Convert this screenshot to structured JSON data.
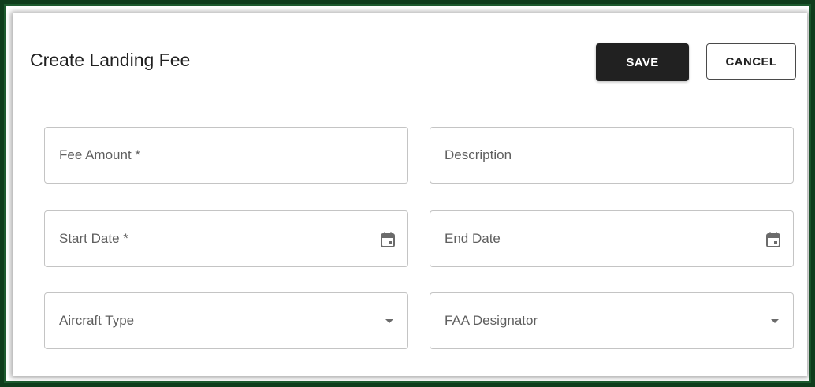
{
  "dialog": {
    "title": "Create Landing Fee",
    "save_label": "SAVE",
    "cancel_label": "CANCEL"
  },
  "fields": {
    "fee_amount": {
      "label": "Fee Amount *",
      "value": ""
    },
    "description": {
      "label": "Description",
      "value": ""
    },
    "start_date": {
      "label": "Start Date *",
      "icon": "calendar-icon",
      "value": ""
    },
    "end_date": {
      "label": "End Date",
      "icon": "calendar-icon",
      "value": ""
    },
    "aircraft_type": {
      "label": "Aircraft Type",
      "icon": "dropdown-arrow-icon",
      "value": ""
    },
    "faa_designator": {
      "label": "FAA Designator",
      "icon": "dropdown-arrow-icon",
      "value": ""
    }
  },
  "colors": {
    "frame": "#0f3d1c",
    "primary_button": "#212121",
    "field_border": "#c4c4c4",
    "label_text": "#5f5f5f"
  }
}
